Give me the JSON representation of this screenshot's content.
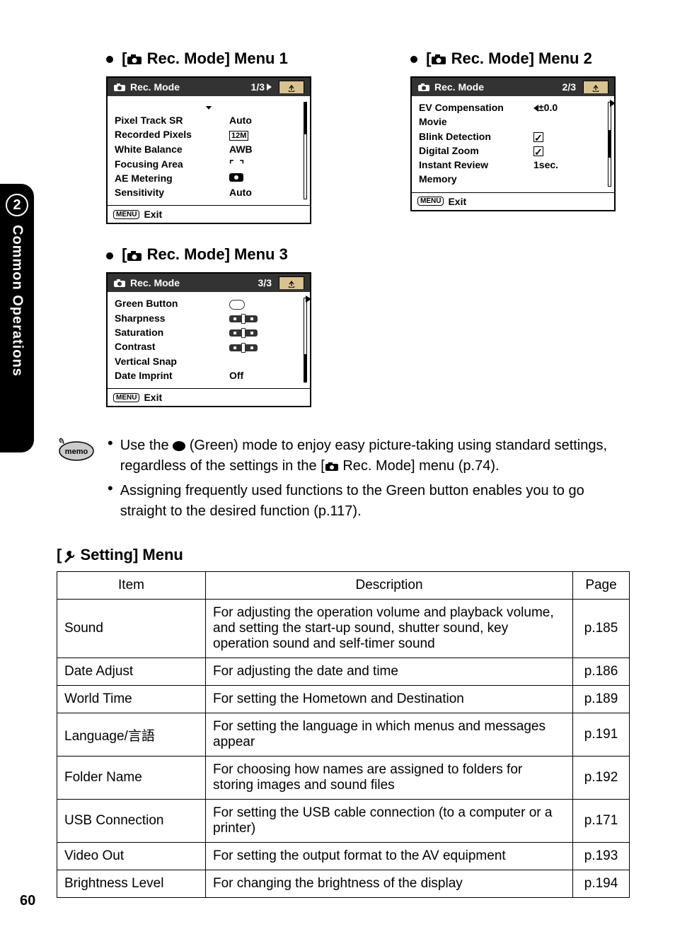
{
  "sideTab": {
    "number": "2",
    "label": "Common Operations"
  },
  "pageNumber": "60",
  "menu1": {
    "title_prefix": "[",
    "title_mid": " Rec. Mode] Menu 1",
    "header": "Rec. Mode",
    "pageInd": "1/3",
    "rows": [
      {
        "label": "Pixel Track SR",
        "value": "Auto"
      },
      {
        "label": "Recorded Pixels",
        "value": "12M"
      },
      {
        "label": "White Balance",
        "value": "AWB"
      },
      {
        "label": "Focusing Area",
        "value": "[  ]"
      },
      {
        "label": "AE Metering",
        "value": "◉"
      },
      {
        "label": "Sensitivity",
        "value": "Auto"
      }
    ],
    "footer": "Exit",
    "footerKey": "MENU"
  },
  "menu2": {
    "title_prefix": "[",
    "title_mid": " Rec. Mode] Menu 2",
    "header": "Rec. Mode",
    "pageInd": "2/3",
    "rows": [
      {
        "label": "EV Compensation",
        "value": "±0.0"
      },
      {
        "label": "Movie",
        "value": ""
      },
      {
        "label": "Blink Detection",
        "value": "check"
      },
      {
        "label": "Digital Zoom",
        "value": "check"
      },
      {
        "label": "Instant Review",
        "value": "1sec."
      },
      {
        "label": "Memory",
        "value": ""
      }
    ],
    "footer": "Exit",
    "footerKey": "MENU"
  },
  "menu3": {
    "title_prefix": "[",
    "title_mid": " Rec. Mode] Menu 3",
    "header": "Rec. Mode",
    "pageInd": "3/3",
    "rows": [
      {
        "label": "Green Button",
        "value": "greenbtn"
      },
      {
        "label": "Sharpness",
        "value": "slider"
      },
      {
        "label": "Saturation",
        "value": "slider"
      },
      {
        "label": "Contrast",
        "value": "slider"
      },
      {
        "label": "Vertical Snap",
        "value": ""
      },
      {
        "label": "Date Imprint",
        "value": "Off"
      }
    ],
    "footer": "Exit",
    "footerKey": "MENU"
  },
  "memo": {
    "item1a": "Use the ",
    "item1b": " (Green) mode to enjoy easy picture-taking using standard settings, regardless of the settings in the [",
    "item1c": " Rec. Mode] menu (p.74).",
    "item2": "Assigning frequently used functions to the Green button enables you to go straight to the desired function (p.117)."
  },
  "settingHeading": " Setting] Menu",
  "settingHeadingPrefix": "[",
  "table": {
    "headers": {
      "item": "Item",
      "desc": "Description",
      "page": "Page"
    },
    "rows": [
      {
        "item": "Sound",
        "desc": "For adjusting the operation volume and playback volume, and setting the start-up sound, shutter sound, key operation sound and self-timer sound",
        "page": "p.185"
      },
      {
        "item": "Date Adjust",
        "desc": "For adjusting the date and time",
        "page": "p.186"
      },
      {
        "item": "World Time",
        "desc": "For setting the Hometown and Destination",
        "page": "p.189"
      },
      {
        "item": "Language/言語",
        "desc": "For setting the language in which menus and messages appear",
        "page": "p.191"
      },
      {
        "item": "Folder Name",
        "desc": "For choosing how names are assigned to folders for storing images and sound files",
        "page": "p.192"
      },
      {
        "item": "USB Connection",
        "desc": "For setting the USB cable connection (to a computer or a printer)",
        "page": "p.171"
      },
      {
        "item": "Video Out",
        "desc": "For setting the output format to the AV equipment",
        "page": "p.193"
      },
      {
        "item": "Brightness Level",
        "desc": "For changing the brightness of the display",
        "page": "p.194"
      }
    ]
  }
}
